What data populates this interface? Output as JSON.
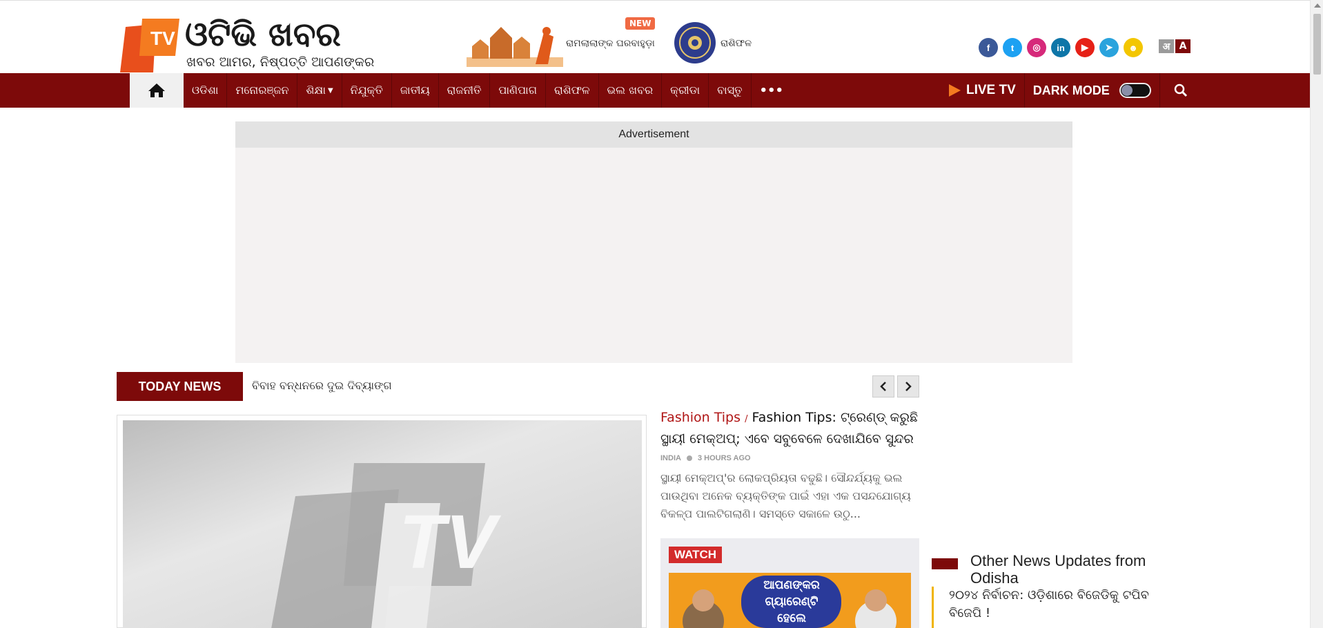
{
  "header": {
    "logo_title": "ଓଟିଭି ଖବର",
    "logo_tagline": "ଖବର ଆମର, ନିଷ୍ପତ୍ତି ଆପଣଙ୍କର",
    "promo_ram_text": "ରାମଲାଲାଙ୍କ ଘରବାହୁଡ଼ା",
    "new_badge": "NEW",
    "promo_rashi_text": "ରାଶିଫଳ",
    "social": [
      {
        "icon": "facebook-icon",
        "glyph": "f",
        "color": "#3b5998"
      },
      {
        "icon": "twitter-icon",
        "glyph": "t",
        "color": "#1da1f2"
      },
      {
        "icon": "instagram-icon",
        "glyph": "◎",
        "color": "#d6297a"
      },
      {
        "icon": "linkedin-icon",
        "glyph": "in",
        "color": "#0e76a8"
      },
      {
        "icon": "youtube-icon",
        "glyph": "▶",
        "color": "#e62117"
      },
      {
        "icon": "telegram-icon",
        "glyph": "➤",
        "color": "#2aa3dd"
      },
      {
        "icon": "snapchat-icon",
        "glyph": "☻",
        "color": "#f3c600"
      }
    ],
    "font_small": "अ",
    "font_large": "A"
  },
  "nav": {
    "items": [
      "ଓଡିଶା",
      "ମନୋରଞ୍ଜନ",
      "ଶିକ୍ଷା",
      "ନିଯୁକ୍ତି",
      "ଜାତୀୟ",
      "ରାଜନୀତି",
      "ପାଣିପାଗ",
      "ରାଶିଫଳ",
      "ଭଲ ଖବର",
      "କ୍ରୀଡା",
      "ବାସ୍ତୁ"
    ],
    "more": "•••",
    "live_tv": "LIVE TV",
    "dark_mode": "DARK MODE"
  },
  "ad": {
    "label": "Advertisement"
  },
  "today": {
    "label": "TODAY NEWS",
    "headline": "ବିବାହ ବନ୍ଧନରେ ଦୁଇ ଦିବ୍ୟାଙ୍ଗ"
  },
  "article": {
    "category": "Fashion Tips",
    "separator": "/",
    "title": "Fashion Tips: ଟ୍ରେଣ୍ଡ୍ କରୁଛି ସ୍ଥାୟୀ ମେକ୍‌ଅପ୍; ଏବେ ସବୁବେଳେ ଦେଖାଯିବେ ସୁନ୍ଦର",
    "meta_location": "INDIA",
    "meta_time": "3 HOURS AGO",
    "description": "ସ୍ଥାୟୀ ମେକ୍‌ଅପ୍'ର ଲୋକପ୍ରିୟତା ବଢୁଛି। ସୌନ୍ଦର୍ଯ୍ୟକୁ ଭଲ ପାଉଥିବା ଅନେକ ବ୍ୟକ୍ତିଙ୍କ ପାଇଁ ଏହା ଏକ ପସନ୍ଦଯୋଗ୍ୟ ବିକଳ୍ପ ପାଲଟିଗଲାଣି। ସମସ୍ତେ ସକାଳେ ଉଠୁ..."
  },
  "watch": {
    "label": "WATCH",
    "banner_text": "ଆପଣଙ୍କର ଗ୍ୟାରେଣ୍ଟି ହେଲେ"
  },
  "other_news": {
    "title": "Other News Updates from Odisha",
    "item": "୨୦୨୪ ନିର୍ବାଚନ: ଓଡ଼ିଶାରେ ବିଜେଡିକୁ ଟପିବ ବିଜେପି !"
  },
  "colors": {
    "brand": "#7d0a0a",
    "accent": "#b01616",
    "watch": "#d32b2b"
  }
}
